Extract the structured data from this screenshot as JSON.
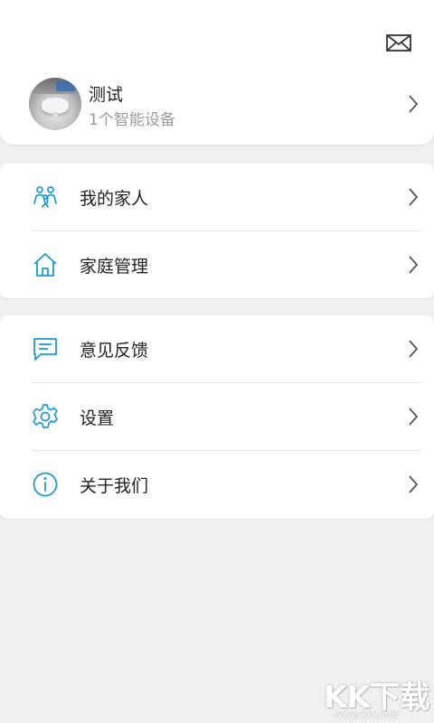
{
  "header": {
    "icon": "mail-icon"
  },
  "profile": {
    "name": "测试",
    "subtitle": "1个智能设备"
  },
  "menu_groups": [
    {
      "items": [
        {
          "label": "我的家人",
          "icon": "family-icon"
        },
        {
          "label": "家庭管理",
          "icon": "home-icon"
        }
      ]
    },
    {
      "items": [
        {
          "label": "意见反馈",
          "icon": "feedback-icon"
        },
        {
          "label": "设置",
          "icon": "gear-icon"
        },
        {
          "label": "关于我们",
          "icon": "info-icon"
        }
      ]
    }
  ],
  "watermark": {
    "logo_text": "KK下载",
    "url": "www.kkx.net"
  },
  "colors": {
    "accent": "#1a9bd6",
    "background": "#f0f0f0",
    "card": "#ffffff",
    "secondary_text": "#9a9a9a"
  }
}
